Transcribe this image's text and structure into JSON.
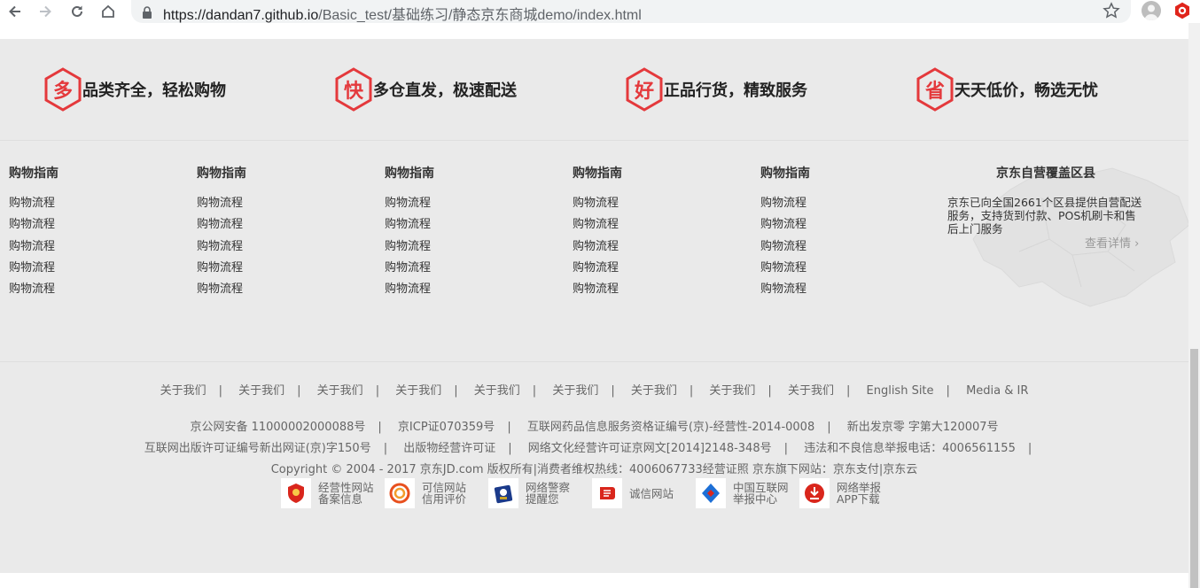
{
  "browser": {
    "url_host": "https://dandan7.github.io",
    "url_path": "/Basic_test/基础练习/静态京东商城demo/index.html"
  },
  "services": [
    {
      "char": "多",
      "text": "品类齐全，轻松购物"
    },
    {
      "char": "快",
      "text": "多仓直发，极速配送"
    },
    {
      "char": "好",
      "text": "正品行货，精致服务"
    },
    {
      "char": "省",
      "text": "天天低价，畅选无忧"
    }
  ],
  "guide_columns": [
    {
      "title": "购物指南",
      "items": [
        "购物流程",
        "购物流程",
        "购物流程",
        "购物流程",
        "购物流程"
      ]
    },
    {
      "title": "购物指南",
      "items": [
        "购物流程",
        "购物流程",
        "购物流程",
        "购物流程",
        "购物流程"
      ]
    },
    {
      "title": "购物指南",
      "items": [
        "购物流程",
        "购物流程",
        "购物流程",
        "购物流程",
        "购物流程"
      ]
    },
    {
      "title": "购物指南",
      "items": [
        "购物流程",
        "购物流程",
        "购物流程",
        "购物流程",
        "购物流程"
      ]
    },
    {
      "title": "购物指南",
      "items": [
        "购物流程",
        "购物流程",
        "购物流程",
        "购物流程",
        "购物流程"
      ]
    }
  ],
  "coverage": {
    "title": "京东自营覆盖区县",
    "text": "京东已向全国2661个区县提供自营配送服务，支持货到付款、POS机刷卡和售后上门服务",
    "link": "查看详情 ›"
  },
  "footer_links": [
    "关于我们",
    "关于我们",
    "关于我们",
    "关于我们",
    "关于我们",
    "关于我们",
    "关于我们",
    "关于我们",
    "关于我们",
    "English Site",
    "Media & IR"
  ],
  "info_line1": [
    "京公网安备 11000002000088号",
    "京ICP证070359号",
    "互联网药品信息服务资格证编号(京)-经营性-2014-0008",
    "新出发京零 字第大120007号"
  ],
  "info_line2": [
    "互联网出版许可证编号新出网证(京)字150号",
    "出版物经营许可证",
    "网络文化经营许可证京网文[2014]2148-348号",
    "违法和不良信息举报电话：4006561155"
  ],
  "copyright": "Copyright © 2004 - 2017  京东JD.com 版权所有|消费者维权热线：4006067733经营证照 京东旗下网站：京东支付|京东云",
  "badges": [
    {
      "line1": "经营性网站",
      "line2": "备案信息",
      "color": "#d9261c"
    },
    {
      "line1": "可信网站",
      "line2": "信用评价",
      "color": "#e8501e"
    },
    {
      "line1": "网络警察",
      "line2": "提醒您",
      "color": "#1b3a8a"
    },
    {
      "line1": "诚信网站",
      "line2": "",
      "color": "#d9261c"
    },
    {
      "line1": "中国互联网",
      "line2": "举报中心",
      "color": "#1d6fd6"
    },
    {
      "line1": "网络举报",
      "line2": "APP下载",
      "color": "#d9261c"
    }
  ],
  "colors": {
    "accent": "#e4393c",
    "page_bg": "#eaeaea"
  }
}
